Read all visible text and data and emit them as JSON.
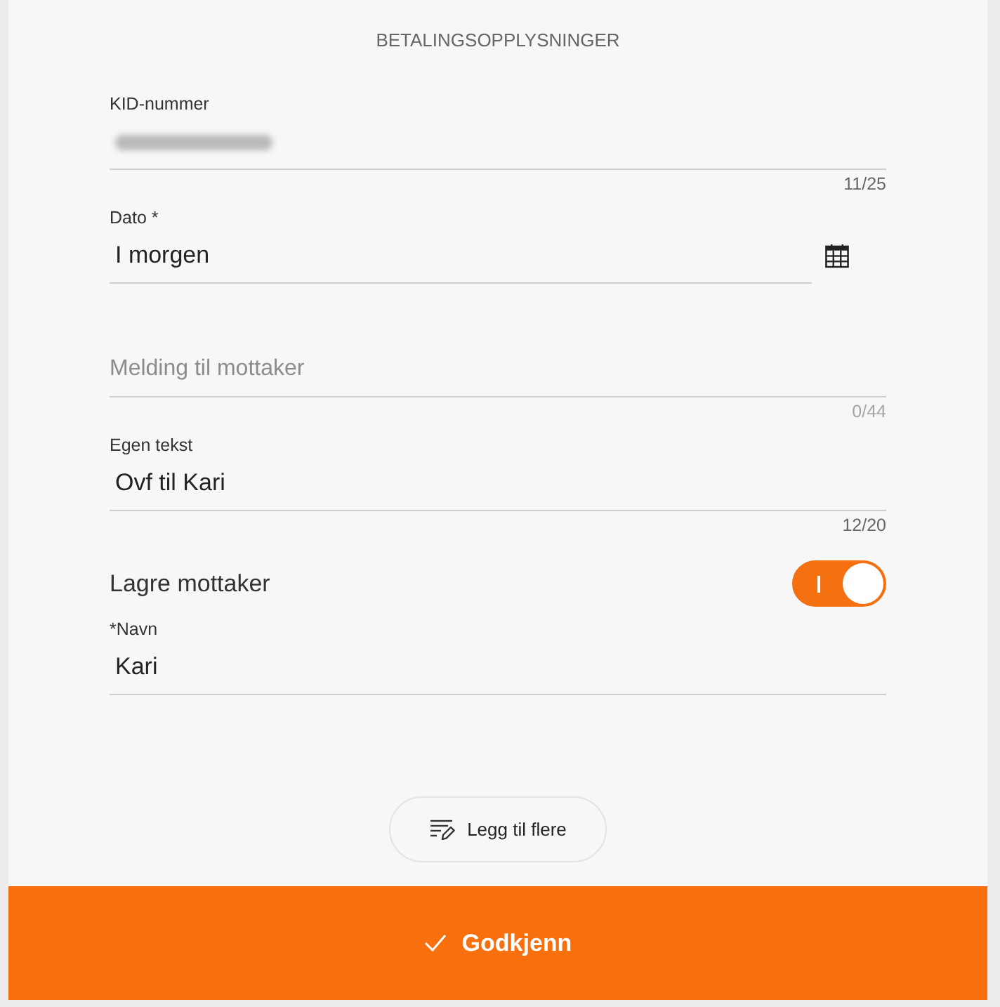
{
  "heading": "BETALINGSOPPLYSNINGER",
  "fields": [
    {
      "kind": "text",
      "label": "KID-nummer",
      "value_redacted": true,
      "counter": "11/25"
    },
    {
      "kind": "date",
      "label": "Dato *",
      "value": "I morgen"
    },
    {
      "kind": "text",
      "placeholder": "Melding til mottaker",
      "counter": "0/44"
    },
    {
      "kind": "text",
      "label": "Egen tekst",
      "value": "Ovf til Kari",
      "counter": "12/20"
    },
    {
      "kind": "toggle",
      "label": "Lagre mottaker",
      "on": true
    },
    {
      "kind": "text",
      "label": "*Navn",
      "value": "Kari"
    }
  ],
  "add_button": {
    "label": "Legg til flere"
  },
  "submit_button": {
    "label": "Godkjenn"
  }
}
